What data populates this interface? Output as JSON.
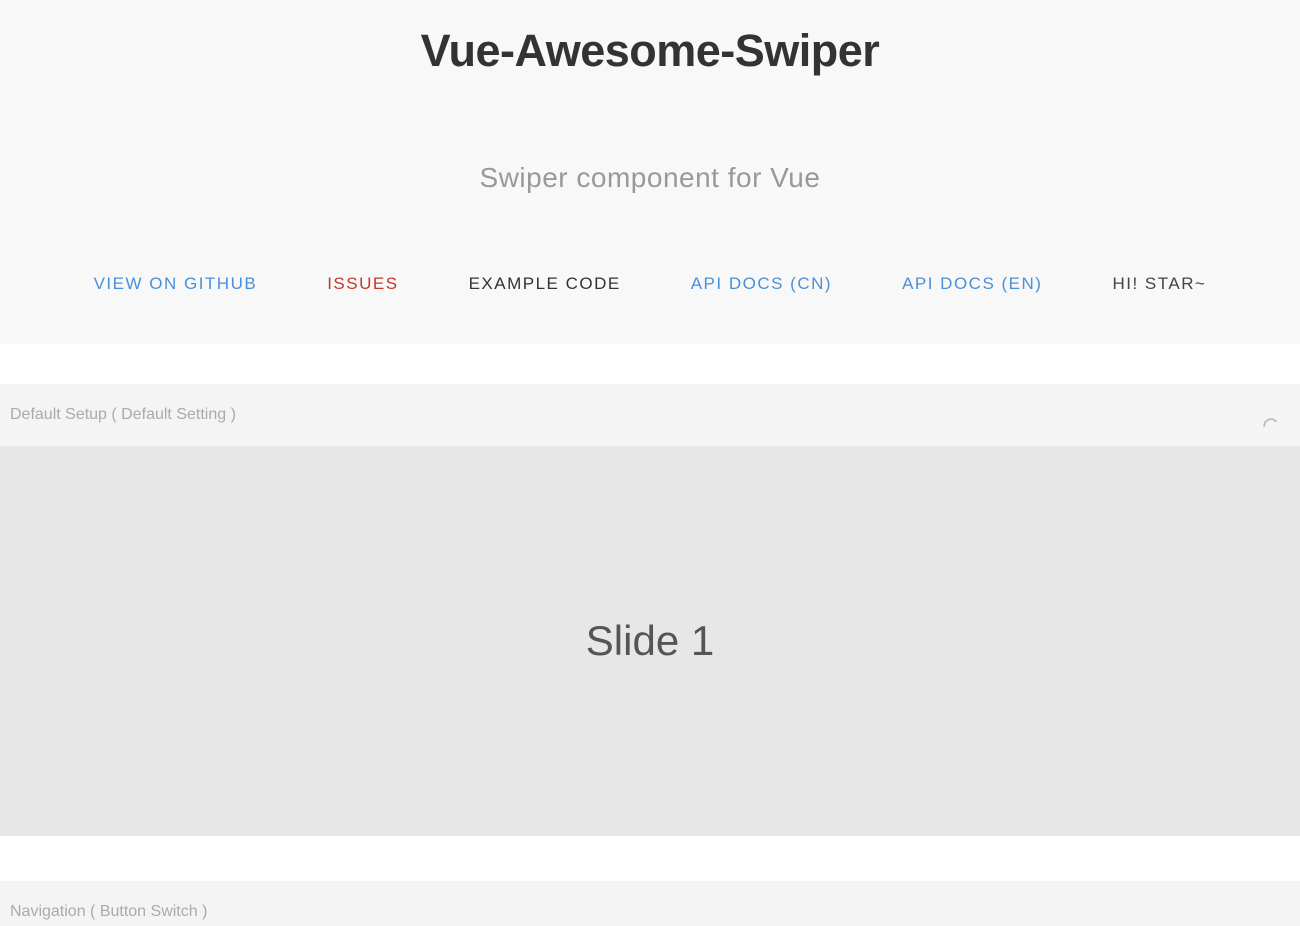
{
  "header": {
    "title": "Vue-Awesome-Swiper",
    "subtitle": "Swiper component for Vue"
  },
  "nav": {
    "items": [
      {
        "label": "VIEW ON GITHUB",
        "style": "blue"
      },
      {
        "label": "ISSUES",
        "style": "red"
      },
      {
        "label": "EXAMPLE CODE",
        "style": "dark"
      },
      {
        "label": "API DOCS (CN)",
        "style": "blue"
      },
      {
        "label": "API DOCS (EN)",
        "style": "blue"
      },
      {
        "label": "HI! STAR~",
        "style": "gray"
      }
    ]
  },
  "sections": {
    "first": {
      "label": "Default Setup ( Default Setting )",
      "slide": "Slide 1"
    },
    "second": {
      "label": "Navigation ( Button Switch )"
    }
  }
}
